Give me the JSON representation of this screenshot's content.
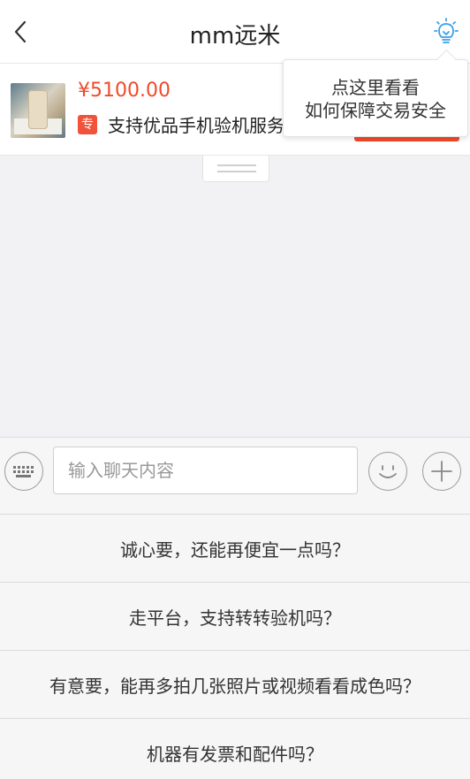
{
  "header": {
    "title": "mm远米",
    "back_icon": "chevron-left-icon",
    "tips_icon": "lightbulb-icon",
    "tips_icon_color": "#3aa0e8"
  },
  "product": {
    "price": "¥5100.00",
    "promo_badge": "专",
    "promo_text": "支持优品手机验机服务",
    "price_color": "#f04a2a"
  },
  "tooltip": {
    "line1": "点这里看看",
    "line2": "如何保障交易安全"
  },
  "chat": {
    "input_placeholder": "输入聊天内容",
    "keyboard_icon": "keyboard-icon",
    "emoji_icon": "emoji-icon",
    "plus_icon": "plus-icon"
  },
  "quick_replies": [
    "诚心要，还能再便宜一点吗？",
    "走平台，支持转转验机吗？",
    "有意要，能再多拍几张照片或视频看看成色吗？",
    "机器有发票和配件吗？"
  ]
}
